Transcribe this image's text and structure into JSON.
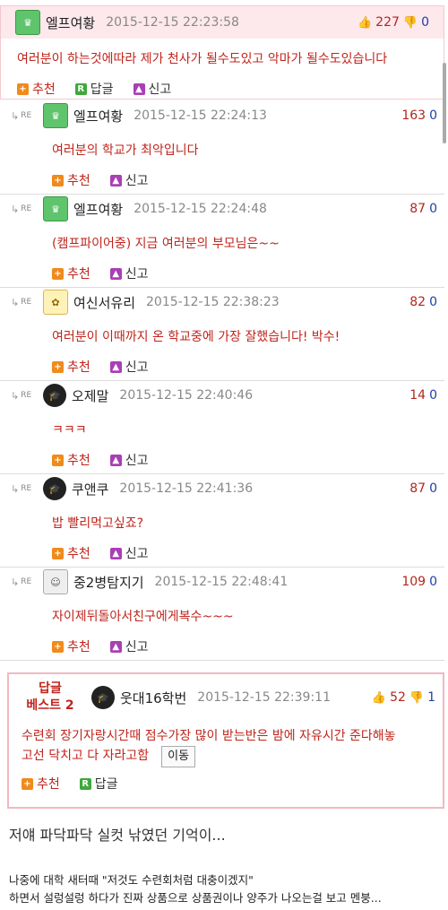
{
  "top_comment": {
    "nick": "엘프여황",
    "date": "2015-12-15 22:23:58",
    "up": "227",
    "down": "0",
    "text": "여러분이 하는것에따라 제가 천사가 될수도있고 악마가 될수도있습니다",
    "actions": {
      "recommend": "추천",
      "reply": "답글",
      "report": "신고"
    }
  },
  "replies": [
    {
      "nick": "엘프여황",
      "date": "2015-12-15 22:24:13",
      "up": "163",
      "down": "0",
      "text": "여러분의 학교가 최악입니다"
    },
    {
      "nick": "엘프여황",
      "date": "2015-12-15 22:24:48",
      "up": "87",
      "down": "0",
      "text": "(캠프파이어중) 지금 여러분의 부모님은~~"
    },
    {
      "nick": "여신서유리",
      "date": "2015-12-15 22:38:23",
      "up": "82",
      "down": "0",
      "text": "여러분이 이때까지 온 학교중에 가장 잘했습니다! 박수!"
    },
    {
      "nick": "오제말",
      "date": "2015-12-15 22:40:46",
      "up": "14",
      "down": "0",
      "text": "ㅋㅋㅋ"
    },
    {
      "nick": "쿠앤쿠",
      "date": "2015-12-15 22:41:36",
      "up": "87",
      "down": "0",
      "text": "밥 빨리먹고싶죠?"
    },
    {
      "nick": "중2병탐지기",
      "date": "2015-12-15 22:48:41",
      "up": "109",
      "down": "0",
      "text": "자이제뒤돌아서친구에게복수~~~"
    }
  ],
  "reply_marker": "RE",
  "reply_actions": {
    "recommend": "추천",
    "report": "신고"
  },
  "best": {
    "badge_line1": "답글",
    "badge_line2": "베스트 2",
    "nick": "웃대16학번",
    "date": "2015-12-15 22:39:11",
    "up": "52",
    "down": "1",
    "text_line1": "수련회 장기자랑시간때 점수가장 많이 받는반은 밤에 자유시간 준다해놓",
    "text_line2": "고선 닥치고 다 자라고함",
    "move": "이동",
    "actions": {
      "recommend": "추천",
      "reply": "답글"
    }
  },
  "article": {
    "title": "저얘 파닥파닥 실컷 낚였던 기억이...",
    "line1": "나중에 대학 새터때 \"저것도 수련회처럼 대충이겠지\"",
    "line2": "하면서 설렁설렁 하다가 진짜 상품으로 상품권이나 양주가 나오는걸 보고 멘붕..."
  },
  "colors": {
    "accent_red": "#c0241c",
    "down_blue": "#1f3fa8",
    "best_border": "#f2b7c1",
    "top_header_bg": "#fde8ec"
  },
  "icons": {
    "up": "thumbs-up-icon",
    "down": "thumbs-down-icon",
    "recommend": "plus-square-icon",
    "reply": "reply-r-icon",
    "report": "report-person-icon"
  }
}
